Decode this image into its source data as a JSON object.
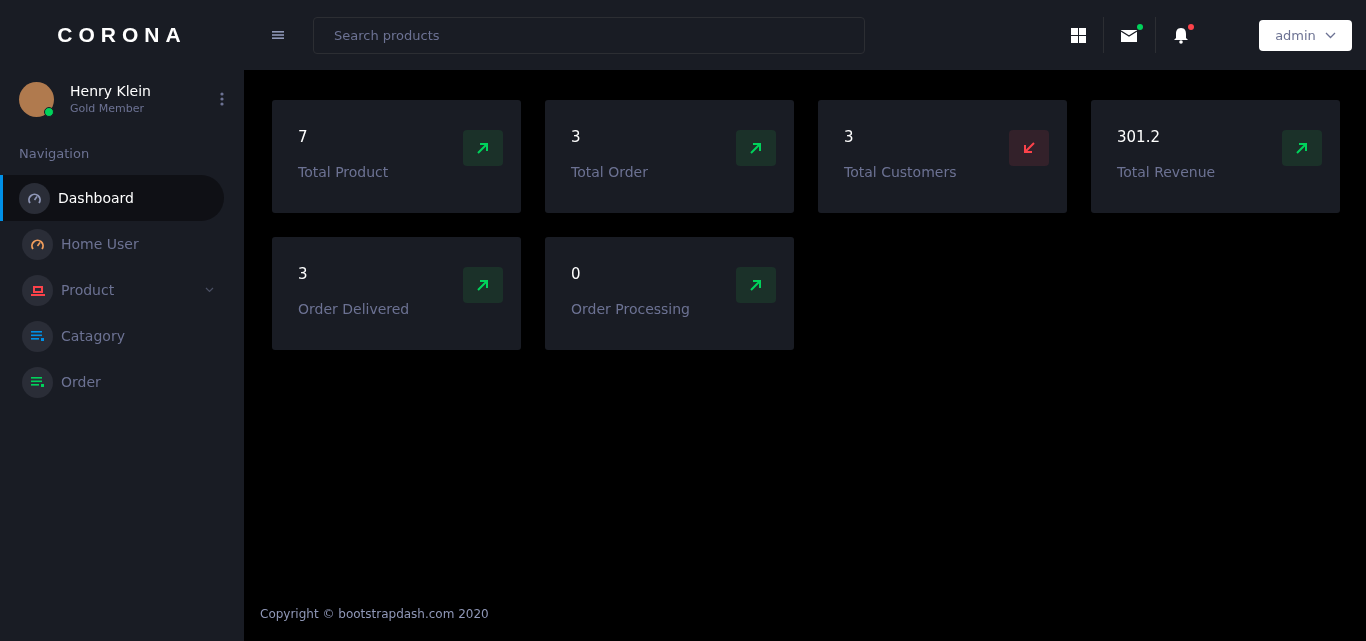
{
  "brand": "CORONA",
  "search": {
    "placeholder": "Search products"
  },
  "header_icons": [
    {
      "kind": "grid",
      "unread": false
    },
    {
      "kind": "mail",
      "unread": true
    },
    {
      "kind": "bell",
      "unread": true
    }
  ],
  "account": {
    "label": "admin"
  },
  "profile": {
    "name": "Henry Klein",
    "role": "Gold Member",
    "online": true
  },
  "nav_heading": "Navigation",
  "nav": [
    {
      "label": "Dashboard",
      "kind": "gauge",
      "color": "#8f97b7",
      "selected": true
    },
    {
      "label": "Home User",
      "kind": "gauge",
      "color": "#f29e5c",
      "selected": false
    },
    {
      "label": "Product",
      "kind": "laptop",
      "color": "#fc424a",
      "selected": false,
      "expanded": false
    },
    {
      "label": "Catagory",
      "kind": "list",
      "color": "#0090e7",
      "selected": false
    },
    {
      "label": "Order",
      "kind": "list",
      "color": "#00d25b",
      "selected": false
    }
  ],
  "stats": [
    {
      "value": "7",
      "label": "Total Product",
      "kind": "up"
    },
    {
      "value": "3",
      "label": "Total Order",
      "kind": "up"
    },
    {
      "value": "3",
      "label": "Total Customers",
      "kind": "down"
    },
    {
      "value": "301.2",
      "label": "Total Revenue",
      "kind": "up"
    },
    {
      "value": "3",
      "label": "Order Delivered",
      "kind": "up"
    },
    {
      "value": "0",
      "label": "Order Processing",
      "kind": "up"
    }
  ],
  "footer": "Copyright © bootstrapdash.com 2020"
}
